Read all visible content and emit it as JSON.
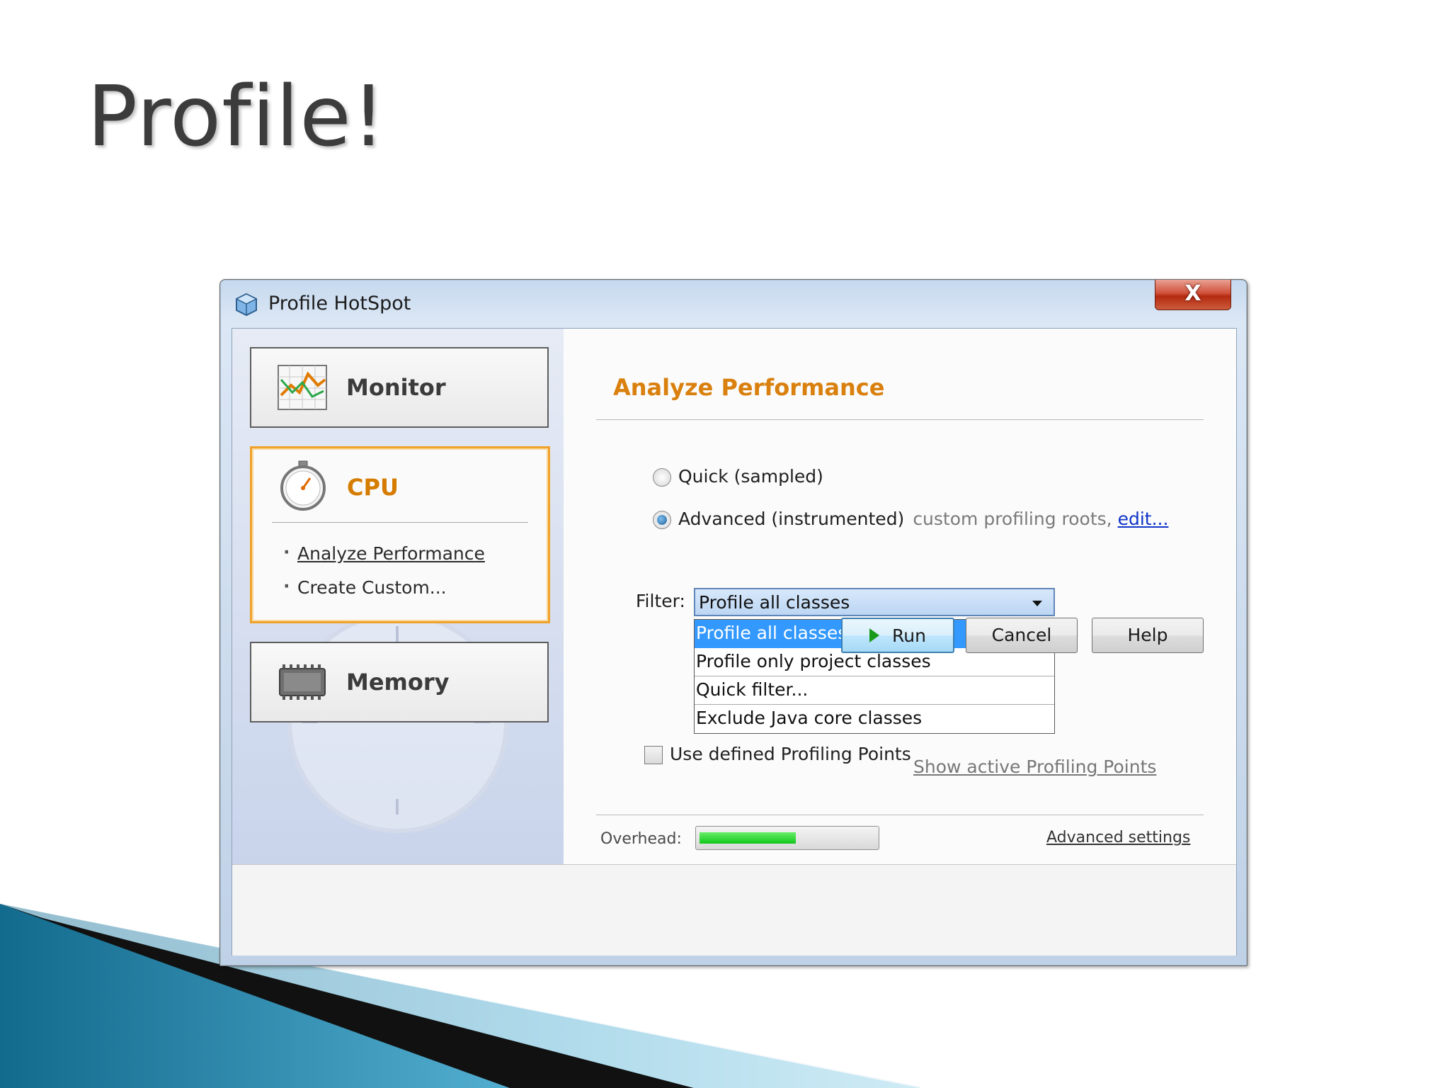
{
  "slide": {
    "title": "Profile!"
  },
  "window": {
    "title": "Profile HotSpot",
    "close_label": "X"
  },
  "categories": {
    "monitor": {
      "label": "Monitor"
    },
    "cpu": {
      "label": "CPU",
      "items": [
        "Analyze Performance",
        "Create Custom..."
      ]
    },
    "memory": {
      "label": "Memory"
    }
  },
  "panel": {
    "title": "Analyze Performance",
    "mode_quick": "Quick (sampled)",
    "mode_advanced": "Advanced (instrumented)",
    "advanced_hint": "custom profiling roots,",
    "edit_link": "edit...",
    "selected_mode": "advanced",
    "filter_label": "Filter:",
    "filter_value": "Profile all classes",
    "filter_options": [
      "Profile all classes",
      "Profile only project classes",
      "Quick filter...",
      "Exclude Java core classes"
    ],
    "filter_selected_index": 0,
    "use_points_label": "Use defined Profiling Points",
    "use_points_checked": false,
    "show_points_link": "Show active Profiling Points",
    "overhead_label": "Overhead:",
    "overhead_fraction": 0.55,
    "advanced_settings_link": "Advanced settings"
  },
  "buttons": {
    "run": "Run",
    "cancel": "Cancel",
    "help": "Help"
  },
  "colors": {
    "accent_orange": "#d9800e",
    "selection_blue": "#3399ff",
    "overhead_green": "#0fc71b",
    "link_blue": "#1034c9"
  },
  "icons": {
    "window": "cube-icon",
    "monitor": "chart-icon",
    "cpu": "stopwatch-icon",
    "memory": "memory-chip-icon",
    "run": "play-icon"
  }
}
